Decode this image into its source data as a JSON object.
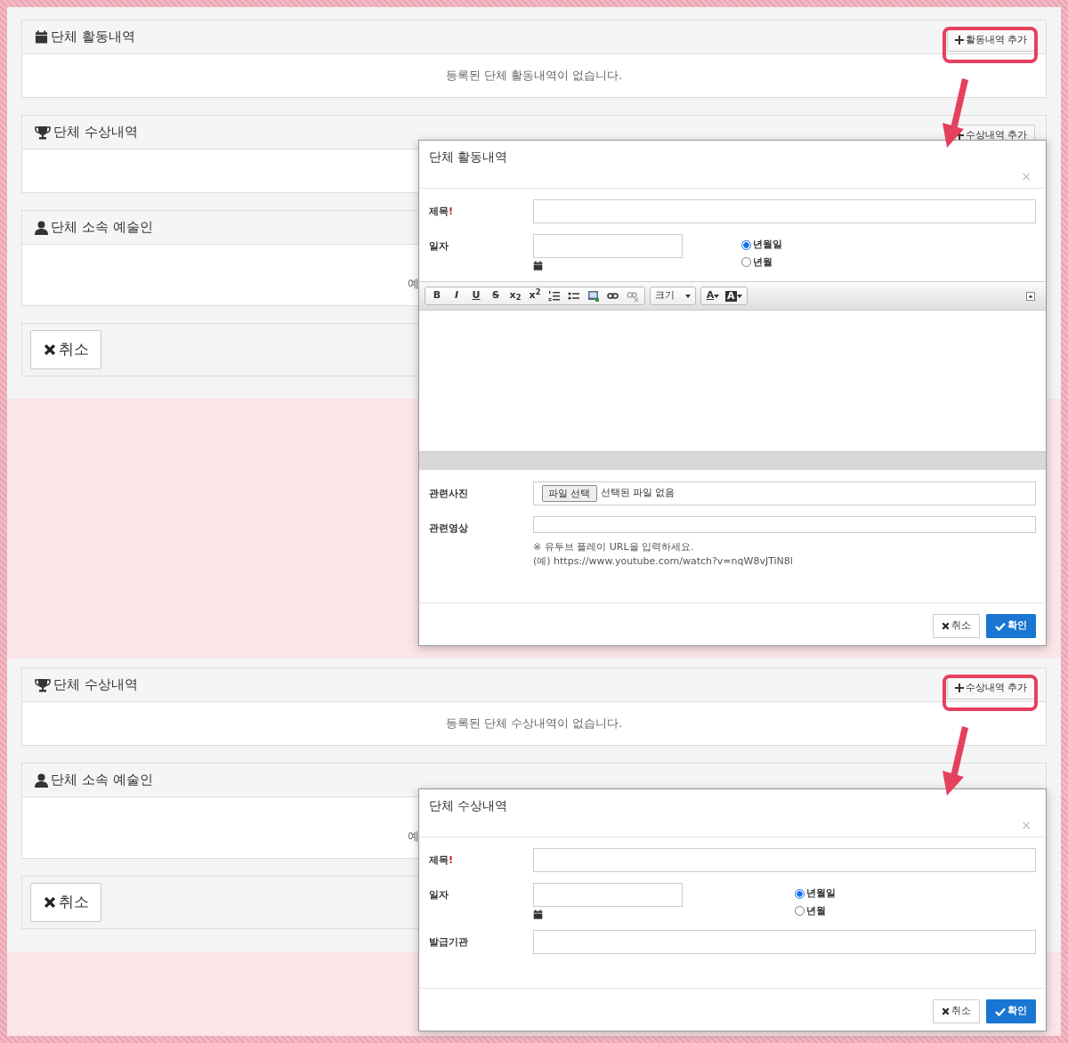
{
  "panes": [
    {
      "panels": [
        {
          "kind": "activity",
          "title": "단체 활동내역",
          "add_button": {
            "label": "활동내역 추가",
            "highlighted": true
          },
          "message": "등록된 단체 활동내역이 없습니다."
        },
        {
          "kind": "award",
          "title": "단체 수상내역",
          "add_button": {
            "label": "수상내역 추가",
            "highlighted": false
          }
        },
        {
          "kind": "artist",
          "title": "단체 소속 예술인",
          "message": "예"
        }
      ],
      "cancel_button": "취소",
      "modal": {
        "title": "단체 활동내역",
        "close": "×",
        "fields": [
          {
            "kind": "text",
            "label": "제목",
            "mark": "!"
          },
          {
            "kind": "date",
            "label": "일자",
            "options": [
              {
                "label": "년월일",
                "selected": true
              },
              {
                "label": "년월",
                "selected": false
              }
            ]
          },
          {
            "kind": "editor",
            "toolbar": [
              [
                {
                  "kind": "bold",
                  "label": "B"
                },
                {
                  "kind": "italic",
                  "label": "I"
                },
                {
                  "kind": "underline",
                  "label": "U"
                },
                {
                  "kind": "strike",
                  "label": "S"
                },
                {
                  "kind": "subscript",
                  "label": "x$_{2}$"
                },
                {
                  "kind": "superscript",
                  "label": "x$^{2}$"
                },
                {
                  "kind": "ordered-list"
                },
                {
                  "kind": "bullet-list"
                },
                {
                  "kind": "image"
                },
                {
                  "kind": "link"
                },
                {
                  "kind": "unlink"
                }
              ],
              [
                {
                  "kind": "dropdown",
                  "label": "크기"
                }
              ],
              [
                {
                  "kind": "font-color",
                  "label": "A"
                },
                {
                  "kind": "back-color",
                  "label": "A"
                }
              ]
            ]
          },
          {
            "kind": "file",
            "label": "관련사진",
            "button": "파일 선택",
            "status": "선택된 파일 없음"
          },
          {
            "kind": "text",
            "label": "관련영상",
            "hints": [
              "※ 유투브 플레이 URL을 입력하세요.",
              "(예) https://www.youtube.com/watch?v=nqW8vJTiN8l"
            ]
          }
        ],
        "buttons": [
          {
            "kind": "cancel",
            "label": "취소"
          },
          {
            "kind": "confirm",
            "label": "확인"
          }
        ]
      }
    },
    {
      "panels": [
        {
          "kind": "award",
          "title": "단체 수상내역",
          "add_button": {
            "label": "수상내역 추가",
            "highlighted": true
          },
          "message": "등록된 단체 수상내역이 없습니다."
        },
        {
          "kind": "artist",
          "title": "단체 소속 예술인",
          "message": "예"
        }
      ],
      "cancel_button": "취소",
      "modal": {
        "title": "단체 수상내역",
        "close": "×",
        "fields": [
          {
            "kind": "text",
            "label": "제목",
            "mark": "!"
          },
          {
            "kind": "date",
            "label": "일자",
            "options": [
              {
                "label": "년월일",
                "selected": true
              },
              {
                "label": "년월",
                "selected": false
              }
            ]
          },
          {
            "kind": "text",
            "label": "발급기관"
          }
        ],
        "buttons": [
          {
            "kind": "cancel",
            "label": "취소"
          },
          {
            "kind": "confirm",
            "label": "확인"
          }
        ]
      }
    }
  ]
}
